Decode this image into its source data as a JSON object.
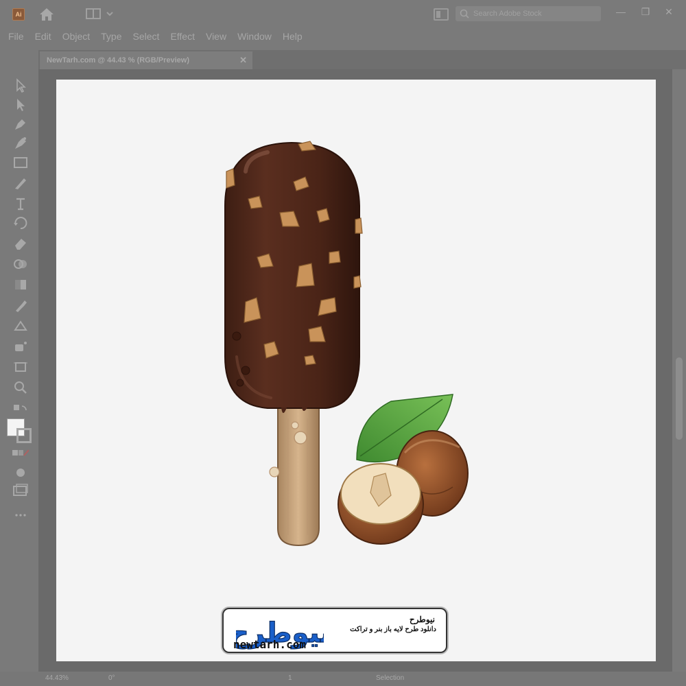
{
  "app": {
    "logo_text": "Ai"
  },
  "search": {
    "placeholder": "Search Adobe Stock"
  },
  "window_controls": {
    "minimize": "—",
    "restore": "❐",
    "close": "✕"
  },
  "menu": [
    "File",
    "Edit",
    "Object",
    "Type",
    "Select",
    "Effect",
    "View",
    "Window",
    "Help"
  ],
  "document": {
    "tab_title": "NewTarh.com @ 44.43 % (RGB/Preview)",
    "close": "✕"
  },
  "status": {
    "zoom": "44.43%",
    "rotation": "0°",
    "artboard": "1",
    "tool": "Selection"
  },
  "watermark": {
    "brand_logo": "نیوطرح",
    "name": "نیوطرح",
    "tagline": "دانلود طرح لایه باز بنر و تراکت",
    "url": "newtarh.com"
  },
  "tools": [
    "selection-tool",
    "direct-selection-tool",
    "pen-tool",
    "curvature-tool",
    "rectangle-tool",
    "paintbrush-tool",
    "type-tool",
    "rotate-tool",
    "eraser-tool",
    "shape-builder-tool",
    "gradient-tool",
    "eyedropper-tool",
    "blend-tool",
    "symbol-sprayer-tool",
    "artboard-tool",
    "zoom-tool"
  ],
  "colors": {
    "chocolate": "#4a2417",
    "chocolate_light": "#6b3a2a",
    "nut": "#c9935a",
    "stick": "#c8a27a",
    "hazelnut": "#8a4a25",
    "leaf": "#4d9a3c",
    "artboard": "#f4f4f4",
    "ui_gray": "#7a7a7a"
  }
}
